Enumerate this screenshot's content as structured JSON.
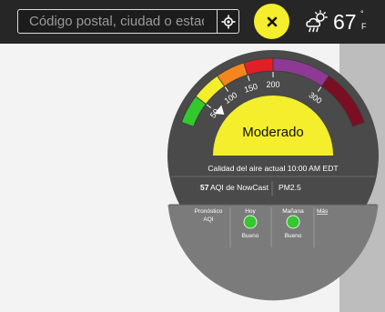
{
  "search": {
    "placeholder": "Código postal, ciudad o estado"
  },
  "icons": {
    "location": "crosshair-icon",
    "close": "close-icon",
    "weather": "partly-cloudy-rain-icon"
  },
  "weather": {
    "temperature": "67",
    "degree_symbol": "°",
    "unit": "F"
  },
  "gauge": {
    "aqi_value": 57,
    "scale_min": 0,
    "scale_max": 400,
    "tick_labels": [
      "50",
      "100",
      "150",
      "200",
      "300"
    ],
    "tick_values": [
      50,
      100,
      150,
      200,
      300
    ],
    "bands": [
      {
        "from": 0,
        "to": 50,
        "color": "#32c82e"
      },
      {
        "from": 50,
        "to": 100,
        "color": "#f4ee2c"
      },
      {
        "from": 100,
        "to": 150,
        "color": "#f5861f"
      },
      {
        "from": 150,
        "to": 200,
        "color": "#e41e26"
      },
      {
        "from": 200,
        "to": 300,
        "color": "#8e3a94"
      },
      {
        "from": 300,
        "to": 400,
        "color": "#7a0f23"
      }
    ],
    "category_label": "Moderado",
    "category_color": "#f4ee2c"
  },
  "current": {
    "heading": "Calidad del aire actual 10:00 AM EDT",
    "aqi_number": "57",
    "aqi_label": "AQI de NowCast",
    "pollutant": "PM2.5"
  },
  "forecast": {
    "label_line1": "Pronóstico",
    "label_line2": "AQI",
    "days": [
      {
        "day": "Hoy",
        "status": "Bueno",
        "color": "#32c82e"
      },
      {
        "day": "Mañana",
        "status": "Bueno",
        "color": "#32c82e"
      }
    ],
    "more_link": "Más"
  }
}
